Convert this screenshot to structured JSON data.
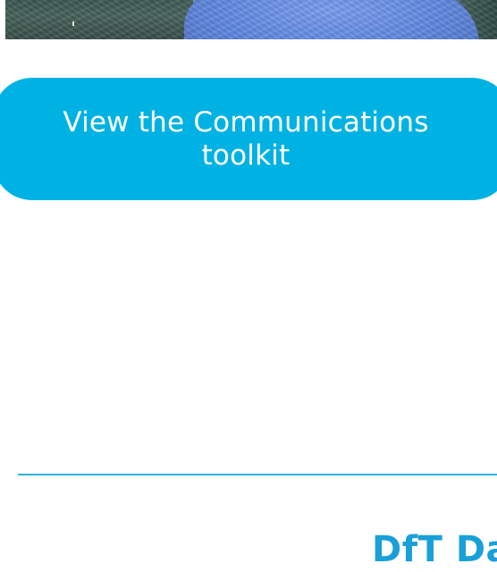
{
  "cta": {
    "label": "View the Communications toolkit"
  },
  "section": {
    "heading": "DfT Da"
  },
  "colors": {
    "button_bg": "#00b2e3",
    "button_text": "#ffffff",
    "divider": "#2bb5df",
    "heading": "#1aa0d8"
  }
}
